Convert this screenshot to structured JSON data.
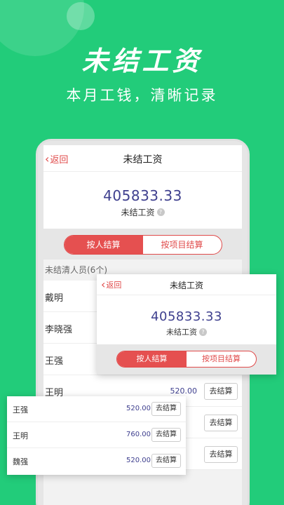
{
  "hero": {
    "title": "未结工资",
    "subtitle": "本月工钱，清晰记录"
  },
  "main_screen": {
    "back_label": "返回",
    "title": "未结工资",
    "amount": "405833.33",
    "amount_label": "未结工资",
    "help_icon_glyph": "?",
    "tabs": [
      {
        "label": "按人结算",
        "active": true
      },
      {
        "label": "按项目结算",
        "active": false
      }
    ],
    "section_header": "未结清人员(6个)",
    "rows": [
      {
        "name": "戴明",
        "amount": "",
        "button": ""
      },
      {
        "name": "李晓强",
        "amount": "",
        "button": ""
      },
      {
        "name": "王强",
        "amount": "",
        "button": ""
      },
      {
        "name": "王明",
        "amount": "520.00",
        "button": "去结算"
      },
      {
        "name": "",
        "amount": "",
        "button": "去结算"
      },
      {
        "name": "",
        "amount": "",
        "button": "去结算"
      }
    ]
  },
  "overlay_card": {
    "back_label": "返回",
    "title": "未结工资",
    "amount": "405833.33",
    "amount_label": "未结工资",
    "tabs": [
      {
        "label": "按人结算",
        "active": true
      },
      {
        "label": "按项目结算",
        "active": false
      }
    ]
  },
  "overlay_list": {
    "rows": [
      {
        "name": "王强",
        "amount": "520.00",
        "button": "去结算"
      },
      {
        "name": "王明",
        "amount": "760.00",
        "button": "去结算"
      },
      {
        "name": "魏强",
        "amount": "520.00",
        "button": "去结算"
      }
    ]
  },
  "colors": {
    "background": "#22cc7a",
    "accent_red": "#e55050",
    "amount_blue": "#3e3f8e"
  }
}
